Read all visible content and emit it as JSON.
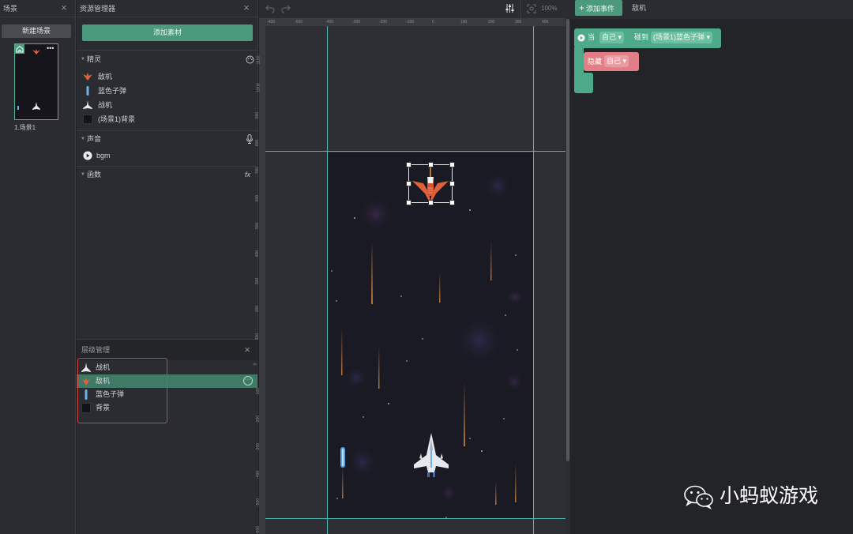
{
  "scene_panel": {
    "title": "场景",
    "new_scene_label": "新建场景",
    "scene_name": "1.场景1"
  },
  "resource_panel": {
    "title": "资源管理器",
    "add_asset_label": "添加素材",
    "sections": [
      {
        "label": "精灵",
        "items": [
          "敌机",
          "蓝色子弹",
          "战机",
          "(场景1)背景"
        ]
      },
      {
        "label": "声音",
        "items": [
          "bgm"
        ]
      },
      {
        "label": "函数",
        "items": []
      }
    ],
    "function_icon": "fx"
  },
  "layer_panel": {
    "title": "层级管理",
    "items": [
      {
        "label": "战机",
        "selected": false
      },
      {
        "label": "敌机",
        "selected": true
      },
      {
        "label": "蓝色子弹",
        "selected": false
      },
      {
        "label": "背景",
        "selected": false
      }
    ],
    "more_icon": "···"
  },
  "canvas": {
    "zoom": "100%",
    "ruler_top_ticks": [
      "-400",
      "-600",
      "-400",
      "-300",
      "-200",
      "-100",
      "0",
      "100",
      "200",
      "300",
      "400"
    ],
    "ruler_left_ticks": [
      "1100",
      "1000",
      "900",
      "800",
      "700",
      "600",
      "500",
      "400",
      "300",
      "200",
      "100",
      "0",
      "-100",
      "-200",
      "-300",
      "-400",
      "-500",
      "-600"
    ]
  },
  "logic_panel": {
    "add_event_label": "添加事件",
    "target_name": "敌机",
    "event_block": {
      "when": "当",
      "subject": "自己",
      "condition": "碰到",
      "object": "(场景1)蓝色子弹"
    },
    "action_block": {
      "action": "隐藏",
      "target": "自己"
    }
  },
  "watermark": {
    "text": "小蚂蚁游戏"
  },
  "colors": {
    "accent": "#4c9a7e",
    "event_block": "#4ea88a",
    "action_block": "#e27f86",
    "highlight": "#d0463e",
    "guide": "#52b8b6"
  }
}
